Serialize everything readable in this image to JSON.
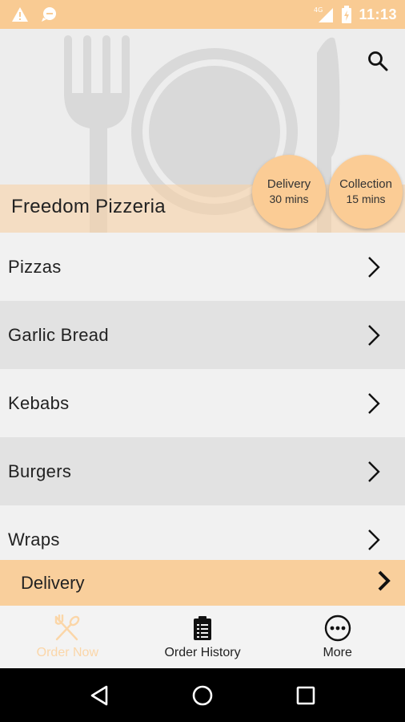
{
  "status_bar": {
    "time": "11:13",
    "network": "4G",
    "icons": [
      "warning-icon",
      "chat-bubble-icon",
      "signal-icon",
      "battery-icon"
    ]
  },
  "header": {
    "restaurant_name": "Freedom Pizzeria",
    "search_icon": "search-icon",
    "delivery_badge": {
      "title": "Delivery",
      "time": "30 mins"
    },
    "collection_badge": {
      "title": "Collection",
      "time": "15 mins"
    }
  },
  "menu": {
    "items": [
      {
        "label": "Pizzas"
      },
      {
        "label": "Garlic Bread"
      },
      {
        "label": "Kebabs"
      },
      {
        "label": "Burgers"
      },
      {
        "label": "Wraps"
      }
    ]
  },
  "delivery_bar": {
    "label": "Delivery"
  },
  "tabs": [
    {
      "label": "Order Now",
      "icon": "fork-spoon-icon",
      "active": true
    },
    {
      "label": "Order History",
      "icon": "clipboard-icon",
      "active": false
    },
    {
      "label": "More",
      "icon": "more-dots-icon",
      "active": false
    }
  ],
  "colors": {
    "accent": "#f9cb93",
    "badge": "#fbcc95",
    "delivery_bar": "#f9cf9c",
    "active_tab": "#fbd6a8"
  }
}
